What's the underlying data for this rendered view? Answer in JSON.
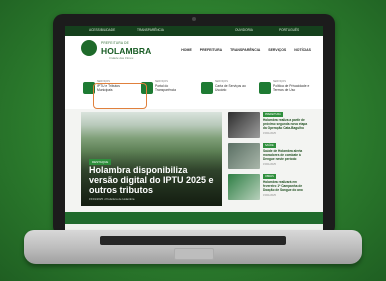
{
  "topbar": {
    "left": "ACESSIBILIDADE",
    "mid": "TRANSPARÊNCIA",
    "right": "OUVIDORIA",
    "langs": "PORTUGUÊS"
  },
  "header": {
    "small": "PREFEITURA DE",
    "title": "HOLAMBRA",
    "subtitle": "Cidade das Flores"
  },
  "nav": [
    "HOME",
    "PREFEITURA",
    "TRANSPARÊNCIA",
    "SERVIÇOS",
    "NOTÍCIAS"
  ],
  "quick_links": [
    {
      "label": "SERVIÇOS",
      "text": "IPTU e Tributos Municipais"
    },
    {
      "label": "SERVIÇOS",
      "text": "Portal do Transparência"
    },
    {
      "label": "SERVIÇOS",
      "text": "Carta de Serviços ao Usuário"
    },
    {
      "label": "SERVIÇOS",
      "text": "Política de Privacidade e Termos de Uso"
    }
  ],
  "hero": {
    "tag": "DESTAQUE",
    "title": "Holambra disponibiliza versão digital do IPTU 2025 e outros tributos",
    "meta": "15/01/2025 • Prefeitura de Holambra"
  },
  "side_news": [
    {
      "tag": "PREFEITURA",
      "title": "Holambra realiza a partir de próximo segunda nova etapa da Operação Cata-Bagulho",
      "date": "15/01/2025"
    },
    {
      "tag": "SAÚDE",
      "title": "Saúde de Holambra alerta moradores de combate à Dengue neste período",
      "date": "15/01/2025"
    },
    {
      "tag": "OBRAS",
      "title": "Holambra realizará em fevereiro 1ª Campanha de Doação de Sangue do ano",
      "date": "15/01/2025"
    }
  ]
}
